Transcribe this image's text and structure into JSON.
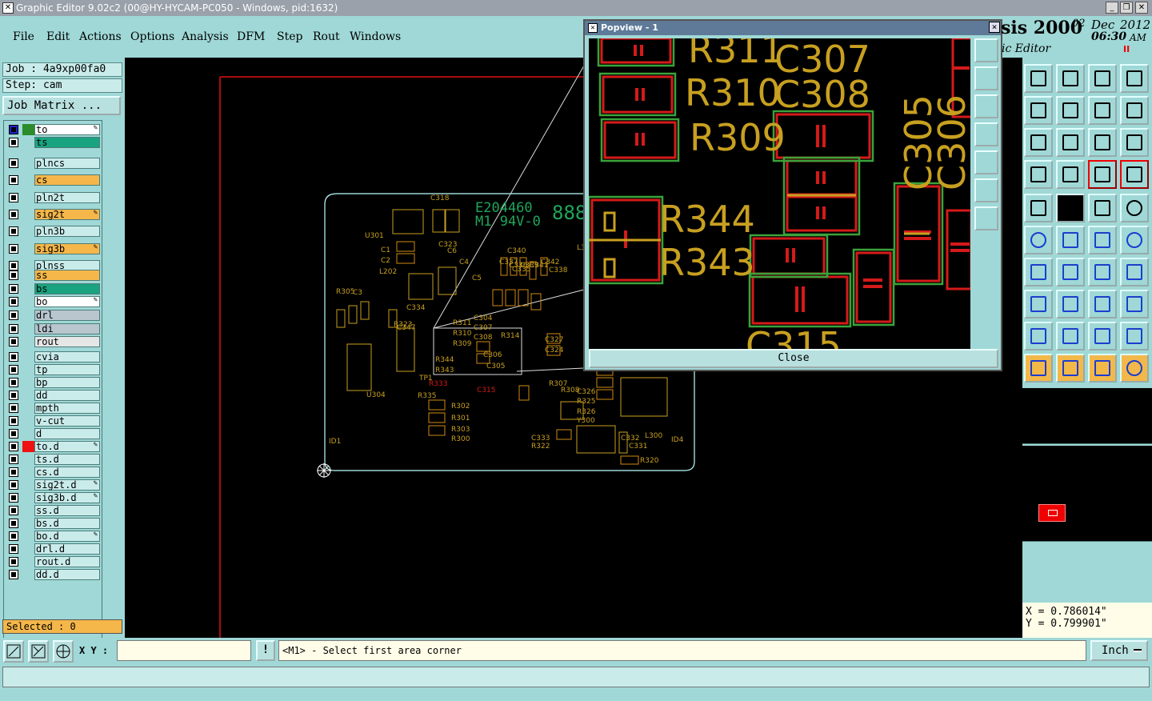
{
  "window": {
    "title": "Graphic Editor 9.02c2 (00@HY-HYCAM-PC050 - Windows, pid:1632)"
  },
  "menu": [
    "File",
    "Edit",
    "Actions",
    "Options",
    "Analysis",
    "DFM",
    "Step",
    "Rout",
    "Windows"
  ],
  "brand": {
    "product": "sis 2000",
    "subtitle": "ic Editor",
    "date_day": "02",
    "date_month": "Dec",
    "date_year": "2012",
    "time": "06:30",
    "ampm": "AM",
    "pause_glyph": "II"
  },
  "job": {
    "job_label": "Job : 4a9xp00fa0",
    "step_label": "Step: cam",
    "matrix_button": "Job Matrix ..."
  },
  "layers": [
    {
      "name": "to",
      "color": "#ffffff",
      "swatch": "#2a8c2a",
      "edit": "true"
    },
    {
      "name": "ts",
      "color": "#19a37e",
      "swatch": ""
    },
    {
      "name": "plncs",
      "color": "#c9eceb",
      "swatch": ""
    },
    {
      "name": "cs",
      "color": "#f5b74a",
      "swatch": ""
    },
    {
      "name": "pln2t",
      "color": "#c9eceb",
      "swatch": ""
    },
    {
      "name": "sig2t",
      "color": "#f5b74a",
      "swatch": "",
      "edit": "true"
    },
    {
      "name": "pln3b",
      "color": "#c9eceb",
      "swatch": ""
    },
    {
      "name": "sig3b",
      "color": "#f5b74a",
      "swatch": "",
      "edit": "true"
    },
    {
      "name": "plnss",
      "color": "#c9eceb",
      "swatch": ""
    },
    {
      "name": "ss",
      "color": "#f5b74a",
      "swatch": ""
    },
    {
      "name": "bs",
      "color": "#19a37e",
      "swatch": ""
    },
    {
      "name": "bo",
      "color": "#ffffff",
      "swatch": "",
      "edit": "true"
    },
    {
      "name": "drl",
      "color": "#b9c6ce",
      "swatch": ""
    },
    {
      "name": "ldi",
      "color": "#b9c6ce",
      "swatch": ""
    },
    {
      "name": "rout",
      "color": "#e6e6e6",
      "swatch": ""
    },
    {
      "name": "cvia",
      "color": "#c9eceb",
      "swatch": ""
    },
    {
      "name": "tp",
      "color": "#c9eceb",
      "swatch": ""
    },
    {
      "name": "bp",
      "color": "#c9eceb",
      "swatch": ""
    },
    {
      "name": "dd",
      "color": "#c9eceb",
      "swatch": ""
    },
    {
      "name": "mpth",
      "color": "#c9eceb",
      "swatch": ""
    },
    {
      "name": "v-cut",
      "color": "#c9eceb",
      "swatch": ""
    },
    {
      "name": "d",
      "color": "#c9eceb",
      "swatch": ""
    },
    {
      "name": "to.d",
      "color": "#c9eceb",
      "swatch": "#ee1111",
      "edit": "true"
    },
    {
      "name": "ts.d",
      "color": "#c9eceb",
      "swatch": ""
    },
    {
      "name": "cs.d",
      "color": "#c9eceb",
      "swatch": ""
    },
    {
      "name": "sig2t.d",
      "color": "#c9eceb",
      "swatch": "",
      "edit": "true"
    },
    {
      "name": "sig3b.d",
      "color": "#c9eceb",
      "swatch": "",
      "edit": "true"
    },
    {
      "name": "ss.d",
      "color": "#c9eceb",
      "swatch": ""
    },
    {
      "name": "bs.d",
      "color": "#c9eceb",
      "swatch": ""
    },
    {
      "name": "bo.d",
      "color": "#c9eceb",
      "swatch": "",
      "edit": "true"
    },
    {
      "name": "drl.d",
      "color": "#c9eceb",
      "swatch": ""
    },
    {
      "name": "rout.d",
      "color": "#c9eceb",
      "swatch": ""
    },
    {
      "name": "dd.d",
      "color": "#c9eceb",
      "swatch": ""
    }
  ],
  "selected": "Selected : 0",
  "popview": {
    "title": "Popview - 1",
    "close_label": "Close",
    "close_glyph": "×"
  },
  "board_labels": {
    "e_mark": "E204460",
    "m_mark": "M1 94V-0",
    "big_888": "888",
    "small": [
      "C318",
      "U301",
      "C1",
      "C2",
      "C3",
      "C4",
      "C5",
      "C6",
      "C323",
      "L202",
      "C334",
      "R323",
      "C347",
      "R311",
      "R310",
      "R309",
      "R344",
      "R343",
      "TP1",
      "R335",
      "R302",
      "R301",
      "R303",
      "R300",
      "C304",
      "C307",
      "C308",
      "C306",
      "C305",
      "C315",
      "R314",
      "C327",
      "C324",
      "C326",
      "R325",
      "R326",
      "C333",
      "R322",
      "C332",
      "C331",
      "Y300",
      "L300",
      "R320",
      "ID1",
      "ID4",
      "U304",
      "C340",
      "C336",
      "C337",
      "C339",
      "C341",
      "C342",
      "C335",
      "C338",
      "L3",
      "R305",
      "R307",
      "R308",
      "R333"
    ]
  },
  "popview_labels": [
    "R311",
    "C307",
    "R310",
    "C308",
    "R309",
    "R344",
    "R343",
    "C305",
    "C306",
    "C315"
  ],
  "coords": {
    "x": "X = 0.786014\"",
    "y": "Y = 0.799901\""
  },
  "status": {
    "xy_label": "X Y :",
    "message": "<M1> - Select first area corner",
    "unit": "Inch",
    "info_glyph": "!"
  }
}
